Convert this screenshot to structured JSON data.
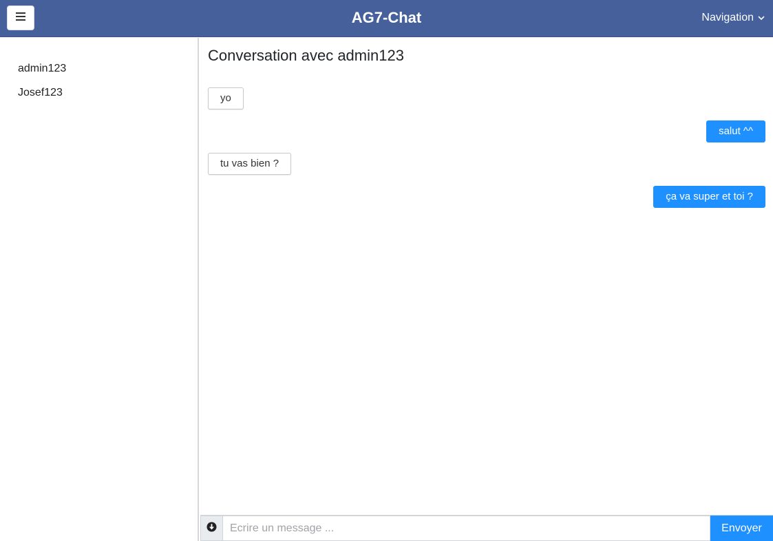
{
  "header": {
    "title": "AG7-Chat",
    "nav_label": "Navigation",
    "menu_icon": "hamburger-icon",
    "nav_icon": "chevron-down-icon",
    "bg_color": "#45609a"
  },
  "sidebar": {
    "contacts": [
      {
        "name": "admin123"
      },
      {
        "name": "Josef123"
      }
    ]
  },
  "conversation": {
    "title": "Conversation avec admin123",
    "messages": [
      {
        "direction": "incoming",
        "text": "yo"
      },
      {
        "direction": "outgoing",
        "text": "salut ^^"
      },
      {
        "direction": "incoming",
        "text": "tu vas bien ?"
      },
      {
        "direction": "outgoing",
        "text": "ça va super et toi ?"
      }
    ]
  },
  "composer": {
    "placeholder": "Ecrire un message ...",
    "value": "",
    "send_label": "Envoyer",
    "attach_icon": "arrow-circle-down-icon",
    "accent_color": "#1e90ff"
  }
}
